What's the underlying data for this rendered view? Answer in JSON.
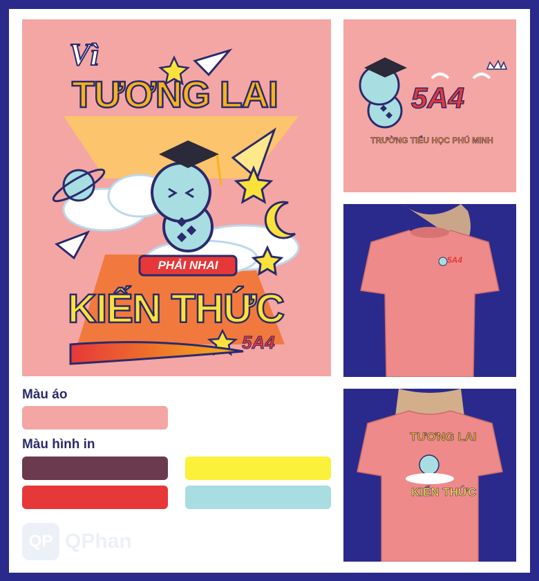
{
  "artwork": {
    "line1": "Vì",
    "line2": "TƯƠNG LAI",
    "ribbon": "PHẢI NHAI",
    "line3": "KIẾN THỨC",
    "class_code": "5A4"
  },
  "badge": {
    "class_code": "5A4",
    "school": "TRƯỜNG TIỂU HỌC PHÚ MINH"
  },
  "front_mockup": {
    "print_text": "5A4"
  },
  "back_mockup": {
    "line1": "TƯƠNG LAI",
    "line2": "KIẾN THỨC"
  },
  "shirt_color": {
    "title": "Màu áo",
    "color": "#f4a6a4"
  },
  "print_colors": {
    "title": "Màu hình in",
    "colors": [
      "#6b3a4e",
      "#fbf03a",
      "#e63838",
      "#a8dde2"
    ]
  },
  "brand": {
    "mark": "QP",
    "name": "QPhan"
  },
  "colors": {
    "frame": "#2a2a8c",
    "background_pink": "#f4a6a4",
    "heading": "#2a2a6c"
  },
  "icons": [
    "paper-plane-icon",
    "star-icon",
    "planet-icon",
    "moon-icon",
    "graduation-cap-icon",
    "cloud-icon",
    "crown-icon",
    "wings-icon"
  ]
}
